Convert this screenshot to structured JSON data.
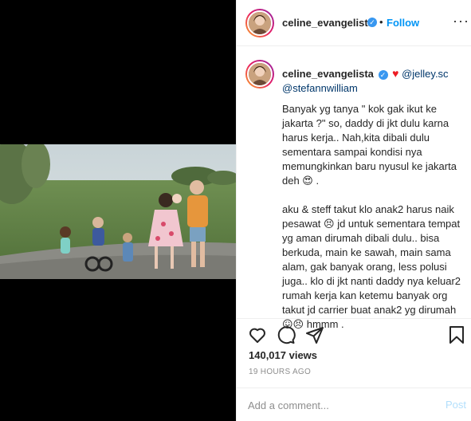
{
  "post": {
    "username": "celine_evangelista",
    "verified_glyph": "✓",
    "follow_label": "Follow",
    "dot": "•",
    "more_glyph": "···"
  },
  "caption": {
    "username": "celine_evangelista",
    "heart": "♥",
    "mention1": "@jelley.sc",
    "mention2": "@stefannwilliam",
    "paragraph1": "Banyak yg tanya \" kok gak ikut ke jakarta ?\" so, daddy di jkt dulu karna harus kerja.. Nah,kita dibali dulu sementara sampai kondisi nya memungkinkan baru nyusul ke jakarta deh 😍 .",
    "paragraph2": "aku & steff takut klo anak2 harus naik pesawat 😣 jd untuk sementara tempat yg aman dirumah dibali dulu.. bisa berkuda, main ke sawah, main sama alam, gak banyak orang, less polusi juga.. klo di jkt nanti daddy nya keluar2 rumah kerja kan ketemu banyak org takut jd carrier buat anak2 yg dirumah 😖😣 hmmm ."
  },
  "stats": {
    "views": "140,017 views",
    "time": "19 HOURS AGO"
  },
  "comment": {
    "placeholder": "Add a comment...",
    "post_label": "Post"
  },
  "icons": {
    "like": "heart-icon",
    "comment": "comment-icon",
    "share": "share-icon",
    "save": "bookmark-icon"
  },
  "colors": {
    "accent": "#0095f6",
    "muted": "#8e8e8e",
    "post_disabled": "#b2dffc",
    "verified": "#3897f0"
  }
}
